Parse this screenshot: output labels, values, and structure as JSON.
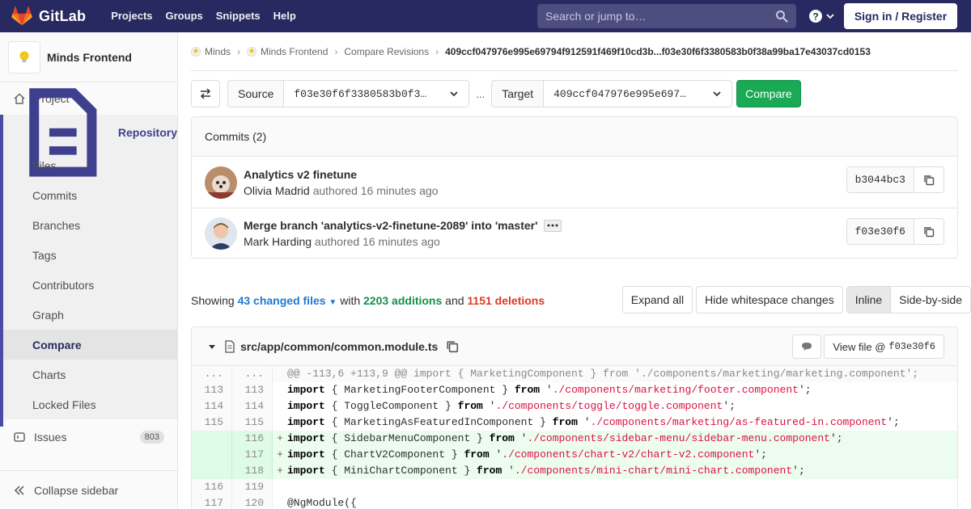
{
  "navbar": {
    "brand": "GitLab",
    "links": [
      "Projects",
      "Groups",
      "Snippets",
      "Help"
    ],
    "search_placeholder": "Search or jump to…",
    "signin_label": "Sign in / Register"
  },
  "sidebar": {
    "project_name": "Minds Frontend",
    "project_item": "Project",
    "repository_label": "Repository",
    "repo_items": [
      "Files",
      "Commits",
      "Branches",
      "Tags",
      "Contributors",
      "Graph",
      "Compare",
      "Charts",
      "Locked Files"
    ],
    "active_item": "Compare",
    "issues_label": "Issues",
    "issues_count": "803",
    "collapse_label": "Collapse sidebar"
  },
  "breadcrumb": {
    "items": [
      "Minds",
      "Minds Frontend",
      "Compare Revisions"
    ],
    "current": "409ccf047976e995e69794f912591f469f10cd3b...f03e30f6f3380583b0f38a99ba17e43037cd0153"
  },
  "compare": {
    "source_label": "Source",
    "source_value": "f03e30f6f3380583b0f3…",
    "separator": "...",
    "target_label": "Target",
    "target_value": "409ccf047976e995e697…",
    "compare_button": "Compare"
  },
  "commits": {
    "header": "Commits (2)",
    "items": [
      {
        "title": "Analytics v2 finetune",
        "author": "Olivia Madrid",
        "meta": "authored 16 minutes ago",
        "sha": "b3044bc3"
      },
      {
        "title": "Merge branch 'analytics-v2-finetune-2089' into 'master'",
        "author": "Mark Harding",
        "meta": "authored 16 minutes ago",
        "sha": "f03e30f6"
      }
    ]
  },
  "stats": {
    "showing": "Showing",
    "files": "43 changed files",
    "with": "with",
    "additions": "2203 additions",
    "and": "and",
    "deletions": "1151 deletions",
    "expand_all": "Expand all",
    "hide_whitespace": "Hide whitespace changes",
    "inline": "Inline",
    "side_by_side": "Side-by-side"
  },
  "file": {
    "path": "src/app/common/common.module.ts",
    "view_file_label": "View file @",
    "view_file_sha": "f03e30f6"
  },
  "diff_lines": [
    {
      "old": "...",
      "new": "...",
      "type": "match",
      "sign": "",
      "code": "@@ -113,6 +113,9 @@ import { MarketingComponent } from './components/marketing/marketing.component';"
    },
    {
      "old": "113",
      "new": "113",
      "type": "context",
      "sign": "",
      "kw": "import",
      "pre": " { MarketingFooterComponent } ",
      "kw2": "from",
      "mid": " '",
      "str": "./components/marketing/footer.component",
      "post": "';"
    },
    {
      "old": "114",
      "new": "114",
      "type": "context",
      "sign": "",
      "kw": "import",
      "pre": " { ToggleComponent } ",
      "kw2": "from",
      "mid": " '",
      "str": "./components/toggle/toggle.component",
      "post": "';"
    },
    {
      "old": "115",
      "new": "115",
      "type": "context",
      "sign": "",
      "kw": "import",
      "pre": " { MarketingAsFeaturedInComponent } ",
      "kw2": "from",
      "mid": " '",
      "str": "./components/marketing/as-featured-in.component",
      "post": "';"
    },
    {
      "old": "",
      "new": "116",
      "type": "added",
      "sign": "+",
      "kw": "import",
      "pre": " { SidebarMenuComponent } ",
      "kw2": "from",
      "mid": " '",
      "str": "./components/sidebar-menu/sidebar-menu.component",
      "post": "';"
    },
    {
      "old": "",
      "new": "117",
      "type": "added",
      "sign": "+",
      "kw": "import",
      "pre": " { ChartV2Component } ",
      "kw2": "from",
      "mid": " '",
      "str": "./components/chart-v2/chart-v2.component",
      "post": "';"
    },
    {
      "old": "",
      "new": "118",
      "type": "added",
      "sign": "+",
      "kw": "import",
      "pre": " { MiniChartComponent } ",
      "kw2": "from",
      "mid": " '",
      "str": "./components/mini-chart/mini-chart.component",
      "post": "';"
    },
    {
      "old": "116",
      "new": "119",
      "type": "context",
      "sign": "",
      "plain": ""
    },
    {
      "old": "117",
      "new": "120",
      "type": "context",
      "sign": "",
      "plain": "@NgModule({"
    }
  ]
}
